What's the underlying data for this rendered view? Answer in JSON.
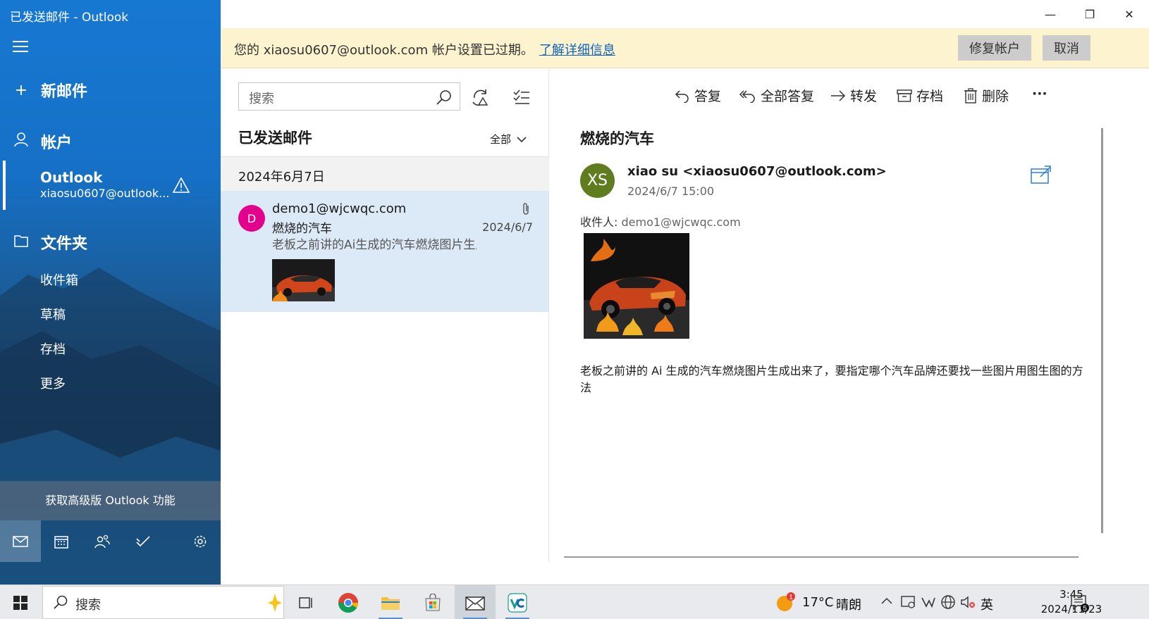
{
  "window": {
    "title": "已发送邮件 - Outlook",
    "minimize": "—",
    "maximize": "❐",
    "close": "✕"
  },
  "sidebar": {
    "new_mail": "新邮件",
    "accounts": "帐户",
    "account_name": "Outlook",
    "account_email": "xiaosu0607@outlook...",
    "folders_heading": "文件夹",
    "folders": [
      "收件箱",
      "草稿",
      "存档",
      "更多"
    ],
    "premium": "获取高级版 Outlook 功能"
  },
  "banner": {
    "message": "您的 xiaosu0607@outlook.com 帐户设置已过期。",
    "link": "了解详细信息",
    "fix_button": "修复帐户",
    "cancel_button": "取消"
  },
  "list": {
    "search_placeholder": "搜索",
    "folder_title": "已发送邮件",
    "filter": "全部",
    "date_header": "2024年6月7日",
    "item": {
      "avatar": "D",
      "from": "demo1@wjcwqc.com",
      "subject": "燃烧的汽车",
      "preview": "老板之前讲的Ai生成的汽车燃烧图片生成出来了",
      "date": "2024/6/7"
    }
  },
  "reading": {
    "toolbar": {
      "reply": "答复",
      "reply_all": "全部答复",
      "forward": "转发",
      "archive": "存档",
      "delete": "删除",
      "more": "···"
    },
    "subject": "燃烧的汽车",
    "avatar": "XS",
    "from": "xiao su <xiaosu0607@outlook.com>",
    "time": "2024/6/7 15:00",
    "to_label": "收件人:",
    "to_value": "demo1@wjcwqc.com",
    "body": "老板之前讲的 Ai 生成的汽车燃烧图片生成出来了，要指定哪个汽车品牌还要找一些图片用图生图的方法"
  },
  "taskbar": {
    "search_placeholder": "搜索",
    "weather_temp": "17°C",
    "weather_text": "晴朗",
    "weather_badge": "1",
    "ime": "英",
    "time": "3:45",
    "date": "2024/11/23",
    "notify_count": "5"
  },
  "colors": {
    "sidebar_blue": "#1778d2",
    "banner_bg": "#fdf3cf",
    "selected_item": "#dce9f6",
    "avatar_d": "#e3008c",
    "avatar_xs": "#5f7d1f",
    "link": "#0e63c0"
  }
}
